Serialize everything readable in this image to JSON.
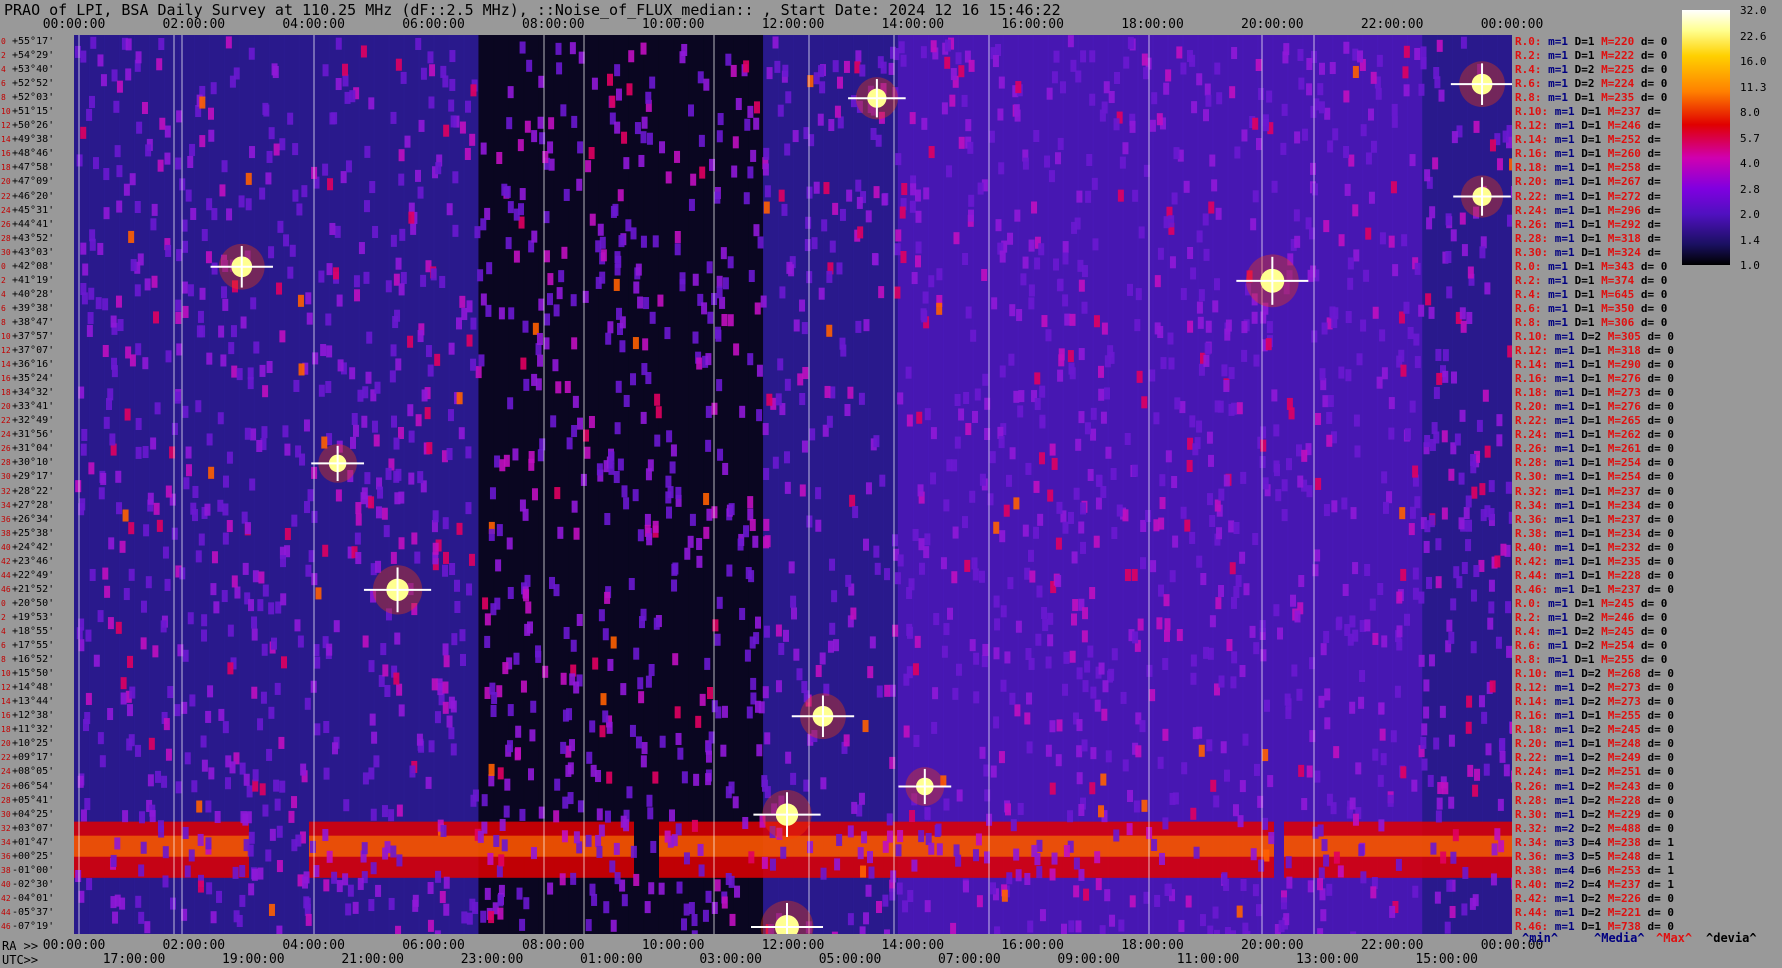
{
  "title": "PRAO of LPI, BSA Daily Survey at 110.25 MHz (dF::2.5 MHz), ::Noise_of_FLUX_median:: , Start Date: 2024 12 16 15:46:22",
  "chart_data": {
    "type": "heatmap",
    "top_ticks": [
      "00:00:00",
      "02:00:00",
      "04:00:00",
      "06:00:00",
      "08:00:00",
      "10:00:00",
      "12:00:00",
      "14:00:00",
      "16:00:00",
      "18:00:00",
      "20:00:00",
      "22:00:00",
      "00:00:00"
    ],
    "ra_axis_label": "RA >>",
    "ra_ticks": [
      "00:00:00",
      "02:00:00",
      "04:00:00",
      "06:00:00",
      "08:00:00",
      "10:00:00",
      "12:00:00",
      "14:00:00",
      "16:00:00",
      "18:00:00",
      "20:00:00",
      "22:00:00",
      "00:00:00"
    ],
    "utc_axis_label": "UTC>>",
    "utc_ticks": [
      "17:00:00",
      "19:00:00",
      "21:00:00",
      "23:00:00",
      "01:00:00",
      "03:00:00",
      "05:00:00",
      "07:00:00",
      "09:00:00",
      "11:00:00",
      "13:00:00",
      "15:00:00"
    ],
    "dec_ticks": [
      "+55°17'",
      "+54°29'",
      "+53°40'",
      "+52°52'",
      "+52°03'",
      "+51°15'",
      "+50°26'",
      "+49°38'",
      "+48°46'",
      "+47°58'",
      "+47°09'",
      "+46°20'",
      "+45°31'",
      "+44°41'",
      "+43°52'",
      "+43°03'",
      "+42°08'",
      "+41°19'",
      "+40°28'",
      "+39°38'",
      "+38°47'",
      "+37°57'",
      "+37°07'",
      "+36°16'",
      "+35°24'",
      "+34°32'",
      "+33°41'",
      "+32°49'",
      "+31°56'",
      "+31°04'",
      "+30°10'",
      "+29°17'",
      "+28°22'",
      "+27°28'",
      "+26°34'",
      "+25°38'",
      "+24°42'",
      "+23°46'",
      "+22°49'",
      "+21°52'",
      "+20°50'",
      "+19°53'",
      "+18°55'",
      "+17°55'",
      "+16°52'",
      "+15°50'",
      "+14°48'",
      "+13°44'",
      "+12°38'",
      "+11°32'",
      "+10°25'",
      "+09°17'",
      "+08°05'",
      "+06°54'",
      "+05°41'",
      "+04°25'",
      "+03°07'",
      "+01°47'",
      "+00°25'",
      "-01°00'",
      "-02°30'",
      "-04°01'",
      "-05°37'",
      "-07°19'"
    ],
    "row_index": [
      "0",
      "2",
      "4",
      "6",
      "8",
      "10",
      "12",
      "14",
      "16",
      "18",
      "20",
      "22",
      "24",
      "26",
      "28",
      "30",
      "0",
      "2",
      "4",
      "6",
      "8",
      "10",
      "12",
      "14",
      "16",
      "18",
      "20",
      "22",
      "24",
      "26",
      "28",
      "30",
      "32",
      "34",
      "36",
      "38",
      "40",
      "42",
      "44",
      "46",
      "0",
      "2",
      "4",
      "6",
      "8",
      "10",
      "12",
      "14",
      "16",
      "18",
      "20",
      "22",
      "24",
      "26",
      "28",
      "30",
      "32",
      "34",
      "36",
      "38",
      "40",
      "42",
      "44",
      "46"
    ],
    "colorbar": {
      "ticks": [
        "32.0",
        "22.6",
        "16.0",
        "11.3",
        "8.0",
        "5.7",
        "4.0",
        "2.8",
        "2.0",
        "1.4",
        "1.0"
      ],
      "colors": [
        "#000000",
        "#1a1060",
        "#5010c0",
        "#8000e0",
        "#d000b0",
        "#e00000",
        "#ff8000",
        "#ffd000",
        "#ffff90",
        "#ffffff"
      ]
    },
    "bright_sources": [
      {
        "ra_h": 20.0,
        "dec_row": 17,
        "intensity": 1.0
      },
      {
        "ra_h": 11.9,
        "dec_row": 63,
        "intensity": 1.0
      },
      {
        "ra_h": 11.9,
        "dec_row": 55,
        "intensity": 0.9
      },
      {
        "ra_h": 5.4,
        "dec_row": 39,
        "intensity": 0.9
      },
      {
        "ra_h": 2.8,
        "dec_row": 16,
        "intensity": 0.8
      },
      {
        "ra_h": 12.5,
        "dec_row": 48,
        "intensity": 0.8
      },
      {
        "ra_h": 23.5,
        "dec_row": 3,
        "intensity": 0.8
      },
      {
        "ra_h": 23.5,
        "dec_row": 11,
        "intensity": 0.7
      },
      {
        "ra_h": 13.4,
        "dec_row": 4,
        "intensity": 0.7
      },
      {
        "ra_h": 4.4,
        "dec_row": 30,
        "intensity": 0.6
      },
      {
        "ra_h": 14.2,
        "dec_row": 53,
        "intensity": 0.6
      }
    ]
  },
  "stats_rows": [
    {
      "r": "R.0:",
      "m": "m=1",
      "d": "D=1",
      "M": "M=220",
      "x": "d= 0"
    },
    {
      "r": "R.2:",
      "m": "m=1",
      "d": "D=1",
      "M": "M=222",
      "x": "d= 0"
    },
    {
      "r": "R.4:",
      "m": "m=1",
      "d": "D=2",
      "M": "M=225",
      "x": "d= 0"
    },
    {
      "r": "R.6:",
      "m": "m=1",
      "d": "D=2",
      "M": "M=224",
      "x": "d= 0"
    },
    {
      "r": "R.8:",
      "m": "m=1",
      "d": "D=1",
      "M": "M=235",
      "x": "d= 0"
    },
    {
      "r": "R.10:",
      "m": "m=1",
      "d": "D=1",
      "M": "M=237",
      "x": "d="
    },
    {
      "r": "R.12:",
      "m": "m=1",
      "d": "D=1",
      "M": "M=246",
      "x": "d="
    },
    {
      "r": "R.14:",
      "m": "m=1",
      "d": "D=1",
      "M": "M=252",
      "x": "d="
    },
    {
      "r": "R.16:",
      "m": "m=1",
      "d": "D=1",
      "M": "M=260",
      "x": "d="
    },
    {
      "r": "R.18:",
      "m": "m=1",
      "d": "D=1",
      "M": "M=258",
      "x": "d="
    },
    {
      "r": "R.20:",
      "m": "m=1",
      "d": "D=1",
      "M": "M=267",
      "x": "d="
    },
    {
      "r": "R.22:",
      "m": "m=1",
      "d": "D=1",
      "M": "M=272",
      "x": "d="
    },
    {
      "r": "R.24:",
      "m": "m=1",
      "d": "D=1",
      "M": "M=296",
      "x": "d="
    },
    {
      "r": "R.26:",
      "m": "m=1",
      "d": "D=1",
      "M": "M=292",
      "x": "d="
    },
    {
      "r": "R.28:",
      "m": "m=1",
      "d": "D=1",
      "M": "M=318",
      "x": "d="
    },
    {
      "r": "R.30:",
      "m": "m=1",
      "d": "D=1",
      "M": "M=324",
      "x": "d="
    },
    {
      "r": "R.0:",
      "m": "m=1",
      "d": "D=1",
      "M": "M=343",
      "x": "d= 0"
    },
    {
      "r": "R.2:",
      "m": "m=1",
      "d": "D=1",
      "M": "M=374",
      "x": "d= 0"
    },
    {
      "r": "R.4:",
      "m": "m=1",
      "d": "D=1",
      "M": "M=645",
      "x": "d= 0"
    },
    {
      "r": "R.6:",
      "m": "m=1",
      "d": "D=1",
      "M": "M=350",
      "x": "d= 0"
    },
    {
      "r": "R.8:",
      "m": "m=1",
      "d": "D=1",
      "M": "M=306",
      "x": "d= 0"
    },
    {
      "r": "R.10:",
      "m": "m=1",
      "d": "D=2",
      "M": "M=305",
      "x": "d= 0"
    },
    {
      "r": "R.12:",
      "m": "m=1",
      "d": "D=1",
      "M": "M=318",
      "x": "d= 0"
    },
    {
      "r": "R.14:",
      "m": "m=1",
      "d": "D=1",
      "M": "M=290",
      "x": "d= 0"
    },
    {
      "r": "R.16:",
      "m": "m=1",
      "d": "D=1",
      "M": "M=276",
      "x": "d= 0"
    },
    {
      "r": "R.18:",
      "m": "m=1",
      "d": "D=1",
      "M": "M=273",
      "x": "d= 0"
    },
    {
      "r": "R.20:",
      "m": "m=1",
      "d": "D=1",
      "M": "M=276",
      "x": "d= 0"
    },
    {
      "r": "R.22:",
      "m": "m=1",
      "d": "D=1",
      "M": "M=265",
      "x": "d= 0"
    },
    {
      "r": "R.24:",
      "m": "m=1",
      "d": "D=1",
      "M": "M=262",
      "x": "d= 0"
    },
    {
      "r": "R.26:",
      "m": "m=1",
      "d": "D=1",
      "M": "M=261",
      "x": "d= 0"
    },
    {
      "r": "R.28:",
      "m": "m=1",
      "d": "D=1",
      "M": "M=254",
      "x": "d= 0"
    },
    {
      "r": "R.30:",
      "m": "m=1",
      "d": "D=1",
      "M": "M=254",
      "x": "d= 0"
    },
    {
      "r": "R.32:",
      "m": "m=1",
      "d": "D=1",
      "M": "M=237",
      "x": "d= 0"
    },
    {
      "r": "R.34:",
      "m": "m=1",
      "d": "D=1",
      "M": "M=234",
      "x": "d= 0"
    },
    {
      "r": "R.36:",
      "m": "m=1",
      "d": "D=1",
      "M": "M=237",
      "x": "d= 0"
    },
    {
      "r": "R.38:",
      "m": "m=1",
      "d": "D=1",
      "M": "M=234",
      "x": "d= 0"
    },
    {
      "r": "R.40:",
      "m": "m=1",
      "d": "D=1",
      "M": "M=232",
      "x": "d= 0"
    },
    {
      "r": "R.42:",
      "m": "m=1",
      "d": "D=1",
      "M": "M=235",
      "x": "d= 0"
    },
    {
      "r": "R.44:",
      "m": "m=1",
      "d": "D=1",
      "M": "M=228",
      "x": "d= 0"
    },
    {
      "r": "R.46:",
      "m": "m=1",
      "d": "D=1",
      "M": "M=237",
      "x": "d= 0"
    },
    {
      "r": "R.0:",
      "m": "m=1",
      "d": "D=1",
      "M": "M=245",
      "x": "d= 0"
    },
    {
      "r": "R.2:",
      "m": "m=1",
      "d": "D=2",
      "M": "M=246",
      "x": "d= 0"
    },
    {
      "r": "R.4:",
      "m": "m=1",
      "d": "D=2",
      "M": "M=245",
      "x": "d= 0"
    },
    {
      "r": "R.6:",
      "m": "m=1",
      "d": "D=2",
      "M": "M=254",
      "x": "d= 0"
    },
    {
      "r": "R.8:",
      "m": "m=1",
      "d": "D=1",
      "M": "M=255",
      "x": "d= 0"
    },
    {
      "r": "R.10:",
      "m": "m=1",
      "d": "D=2",
      "M": "M=268",
      "x": "d= 0"
    },
    {
      "r": "R.12:",
      "m": "m=1",
      "d": "D=2",
      "M": "M=273",
      "x": "d= 0"
    },
    {
      "r": "R.14:",
      "m": "m=1",
      "d": "D=2",
      "M": "M=273",
      "x": "d= 0"
    },
    {
      "r": "R.16:",
      "m": "m=1",
      "d": "D=1",
      "M": "M=255",
      "x": "d= 0"
    },
    {
      "r": "R.18:",
      "m": "m=1",
      "d": "D=2",
      "M": "M=245",
      "x": "d= 0"
    },
    {
      "r": "R.20:",
      "m": "m=1",
      "d": "D=1",
      "M": "M=248",
      "x": "d= 0"
    },
    {
      "r": "R.22:",
      "m": "m=1",
      "d": "D=2",
      "M": "M=249",
      "x": "d= 0"
    },
    {
      "r": "R.24:",
      "m": "m=1",
      "d": "D=2",
      "M": "M=251",
      "x": "d= 0"
    },
    {
      "r": "R.26:",
      "m": "m=1",
      "d": "D=2",
      "M": "M=243",
      "x": "d= 0"
    },
    {
      "r": "R.28:",
      "m": "m=1",
      "d": "D=2",
      "M": "M=228",
      "x": "d= 0"
    },
    {
      "r": "R.30:",
      "m": "m=1",
      "d": "D=2",
      "M": "M=229",
      "x": "d= 0"
    },
    {
      "r": "R.32:",
      "m": "m=2",
      "d": "D=2",
      "M": "M=488",
      "x": "d= 0"
    },
    {
      "r": "R.34:",
      "m": "m=3",
      "d": "D=4",
      "M": "M=238",
      "x": "d= 1"
    },
    {
      "r": "R.36:",
      "m": "m=3",
      "d": "D=5",
      "M": "M=248",
      "x": "d= 1"
    },
    {
      "r": "R.38:",
      "m": "m=4",
      "d": "D=6",
      "M": "M=253",
      "x": "d= 1"
    },
    {
      "r": "R.40:",
      "m": "m=2",
      "d": "D=4",
      "M": "M=237",
      "x": "d= 1"
    },
    {
      "r": "R.42:",
      "m": "m=1",
      "d": "D=2",
      "M": "M=226",
      "x": "d= 0"
    },
    {
      "r": "R.44:",
      "m": "m=1",
      "d": "D=2",
      "M": "M=221",
      "x": "d= 0"
    },
    {
      "r": "R.46:",
      "m": "m=1",
      "d": "D=1",
      "M": "M=738",
      "x": "d= 0"
    }
  ],
  "footer_keys": {
    "min": "^min^",
    "median": "^Media^",
    "max": "^Max^",
    "devia": "^devia^"
  }
}
